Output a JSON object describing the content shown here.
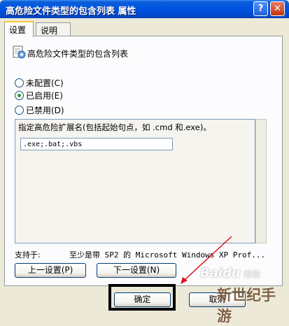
{
  "window": {
    "title": "高危险文件类型的包含列表 属性",
    "help_glyph": "?",
    "close_glyph": "✕"
  },
  "tabs": [
    {
      "label": "设置",
      "active": true
    },
    {
      "label": "说明",
      "active": false
    }
  ],
  "setting": {
    "icon": "policy-setting-icon",
    "title": "高危险文件类型的包含列表"
  },
  "radios": [
    {
      "label": "未配置(C)",
      "checked": false
    },
    {
      "label": "已启用(E)",
      "checked": true
    },
    {
      "label": "已禁用(D)",
      "checked": false
    }
  ],
  "options": {
    "label": "指定高危险扩展名(包括起始句点，如 .cmd 和.exe)。",
    "extensions_value": ".exe;.bat;.vbs"
  },
  "supported": {
    "label": "支持于:",
    "value": "至少是带 SP2 的 Microsoft Windows XP Prof..."
  },
  "nav": {
    "prev_label": "上一设置(P)",
    "next_label": "下一设置(N)"
  },
  "footer": {
    "ok_label": "确定",
    "cancel_label": "取消"
  },
  "annotation": {
    "color": "#e0101a"
  },
  "watermark": {
    "brand": "Baidu",
    "brand_suffix": "经验",
    "site": "新世纪手游"
  }
}
